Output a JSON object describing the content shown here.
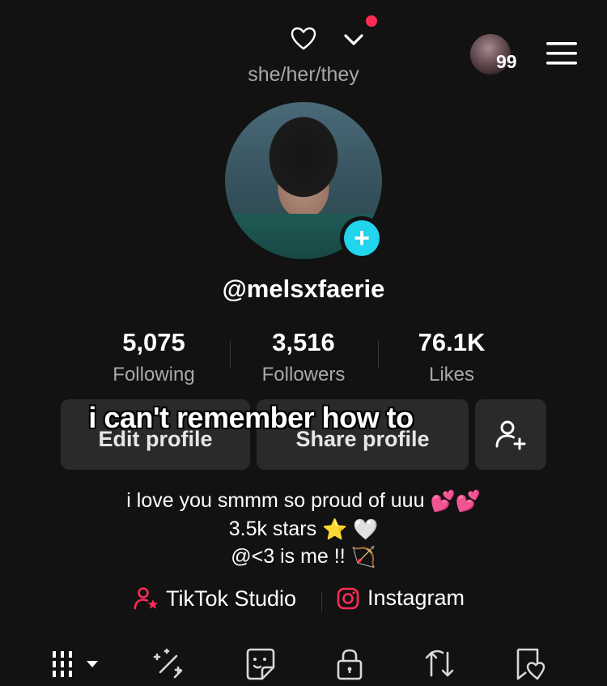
{
  "header": {
    "pronouns": "she/her/they",
    "notification_count": "99",
    "icons": [
      "heart-outline-icon",
      "chevron-down-icon",
      "hamburger-menu-icon"
    ],
    "colors": {
      "notification_dot": "#fe2c55"
    }
  },
  "profile": {
    "username": "@melsxfaerie",
    "avatar_badge_icon": "plus-icon",
    "badge_color": "#20d5ec"
  },
  "stats": [
    {
      "value": "5,075",
      "label": "Following"
    },
    {
      "value": "3,516",
      "label": "Followers"
    },
    {
      "value": "76.1K",
      "label": "Likes"
    }
  ],
  "buttons": {
    "edit_profile": "Edit profile",
    "share_profile": "Share profile",
    "add_friend_icon": "add-person-icon"
  },
  "caption_overlay": "i can't remember how to",
  "bio": {
    "line1": "i love you smmm so proud of uuu",
    "line1_emoji": "💕💕",
    "line2": "3.5k stars",
    "line2_emoji": "⭐ 🤍",
    "line3": "@<3 is me !!",
    "line3_emoji": "🏹"
  },
  "links": {
    "studio": "TikTok Studio",
    "instagram": "Instagram",
    "colors": {
      "accent": "#fe2c55"
    }
  },
  "tabs": {
    "icons": [
      "grid-icon",
      "sparkle-wand-icon",
      "sticker-icon",
      "lock-icon",
      "repost-icon",
      "liked-bookmark-icon"
    ]
  }
}
